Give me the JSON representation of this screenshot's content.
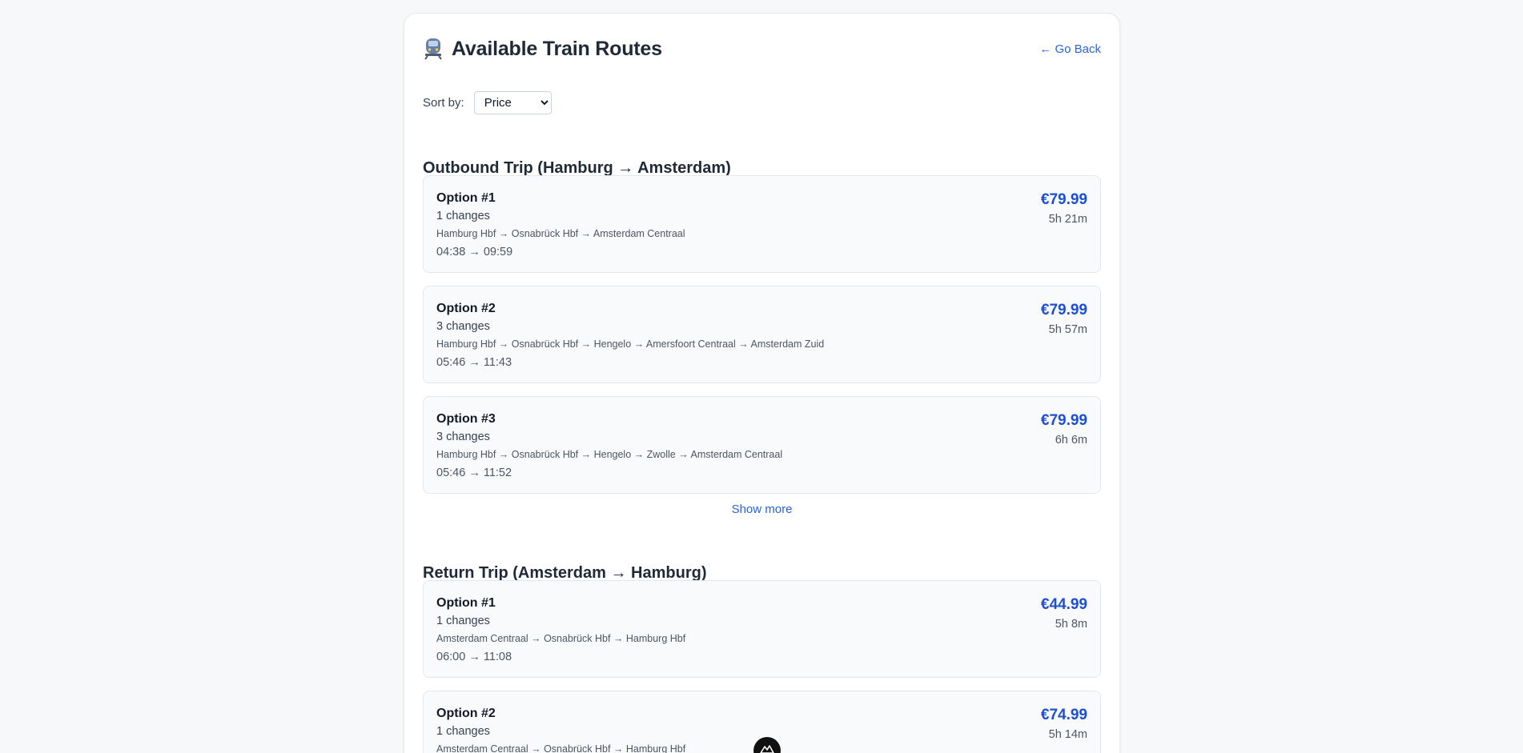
{
  "header": {
    "title": "Available Train Routes",
    "icon": "train-icon",
    "go_back": "← Go Back"
  },
  "sort": {
    "label": "Sort by:",
    "selected": "Price"
  },
  "outbound": {
    "title": "Outbound Trip (Hamburg → Amsterdam)",
    "options": [
      {
        "label": "Option #1",
        "changes": "1 changes",
        "route": "Hamburg Hbf → Osnabrück Hbf → Amsterdam Centraal",
        "times": "04:38 → 09:59",
        "price": "€79.99",
        "duration": "5h 21m"
      },
      {
        "label": "Option #2",
        "changes": "3 changes",
        "route": "Hamburg Hbf → Osnabrück Hbf → Hengelo → Amersfoort Centraal → Amsterdam Zuid",
        "times": "05:46 → 11:43",
        "price": "€79.99",
        "duration": "5h 57m"
      },
      {
        "label": "Option #3",
        "changes": "3 changes",
        "route": "Hamburg Hbf → Osnabrück Hbf → Hengelo → Zwolle → Amsterdam Centraal",
        "times": "05:46 → 11:52",
        "price": "€79.99",
        "duration": "6h 6m"
      }
    ],
    "show_more": "Show more"
  },
  "return": {
    "title": "Return Trip (Amsterdam → Hamburg)",
    "options": [
      {
        "label": "Option #1",
        "changes": "1 changes",
        "route": "Amsterdam Centraal → Osnabrück Hbf → Hamburg Hbf",
        "times": "06:00 → 11:08",
        "price": "€44.99",
        "duration": "5h 8m"
      },
      {
        "label": "Option #2",
        "changes": "1 changes",
        "route": "Amsterdam Centraal → Osnabrück Hbf → Hamburg Hbf",
        "times": "",
        "price": "€74.99",
        "duration": "5h 14m"
      }
    ]
  },
  "colors": {
    "accent": "#2563eb",
    "price": "#1d4ed8",
    "card_bg": "#f9fafb",
    "page_bg": "#f7f8fa"
  }
}
